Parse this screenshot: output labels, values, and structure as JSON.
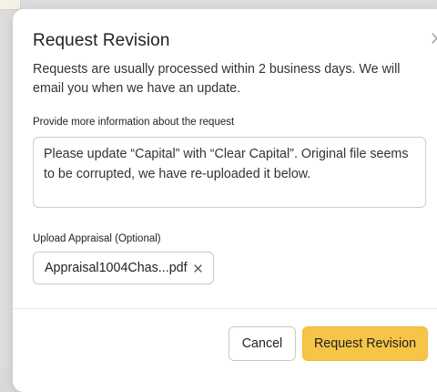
{
  "modal": {
    "title": "Request Revision",
    "intro": "Requests are usually processed within 2 business days. We will email you when we have an update.",
    "info_label": "Provide more information about the request",
    "info_value": "Please update “Capital” with “Clear Capital”. Original file seems to be corrupted, we have re-uploaded it below.",
    "upload_label": "Upload Appraisal (Optional)",
    "file_name": "Appraisal1004Chas...pdf",
    "cancel_label": "Cancel",
    "submit_label": "Request Revision"
  },
  "colors": {
    "primary": "#f6c447",
    "backdrop": "#dcdcdc"
  },
  "icons": {
    "close": "close-icon",
    "remove_file": "close-icon"
  }
}
